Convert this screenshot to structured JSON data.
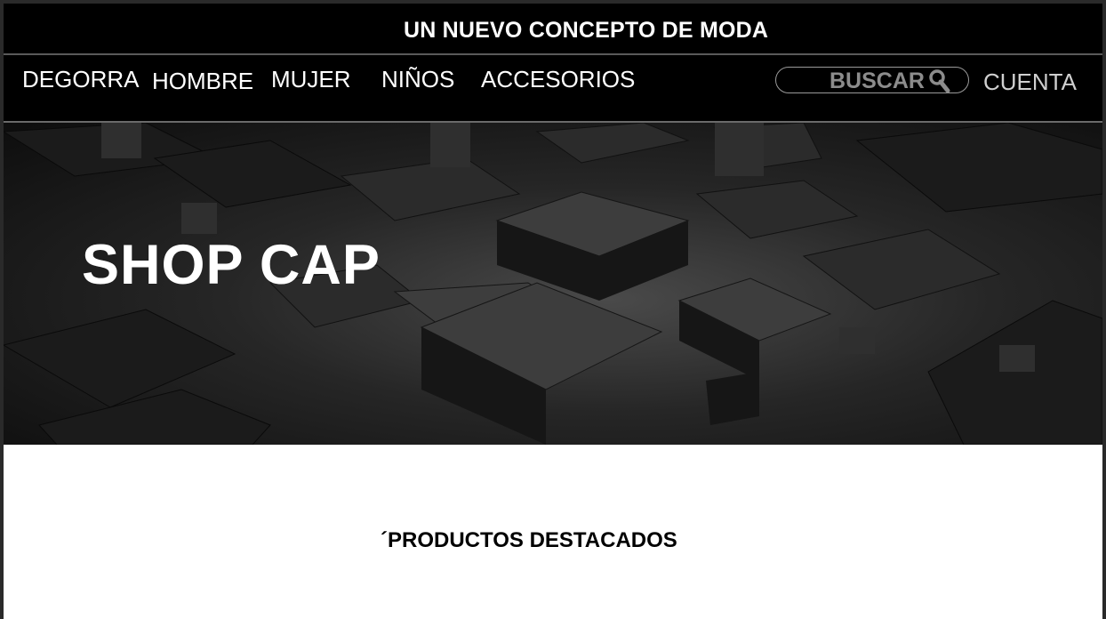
{
  "announcement": {
    "text": "UN NUEVO CONCEPTO DE MODA"
  },
  "nav": {
    "items": [
      {
        "label": "DEGORRA"
      },
      {
        "label": "HOMBRE"
      },
      {
        "label": "MUJER"
      },
      {
        "label": "NIÑOS"
      },
      {
        "label": "ACCESORIOS"
      }
    ],
    "search_label": "BUSCAR",
    "search_icon": "search-icon",
    "account_label": "CUENTA"
  },
  "hero": {
    "title": "SHOP CAP"
  },
  "featured": {
    "title": "´PRODUCTOS DESTACADOS"
  },
  "colors": {
    "header_bg": "#000000",
    "text_primary": "#ffffff",
    "search_text": "#8c8c8c",
    "body_bg": "#ffffff"
  }
}
